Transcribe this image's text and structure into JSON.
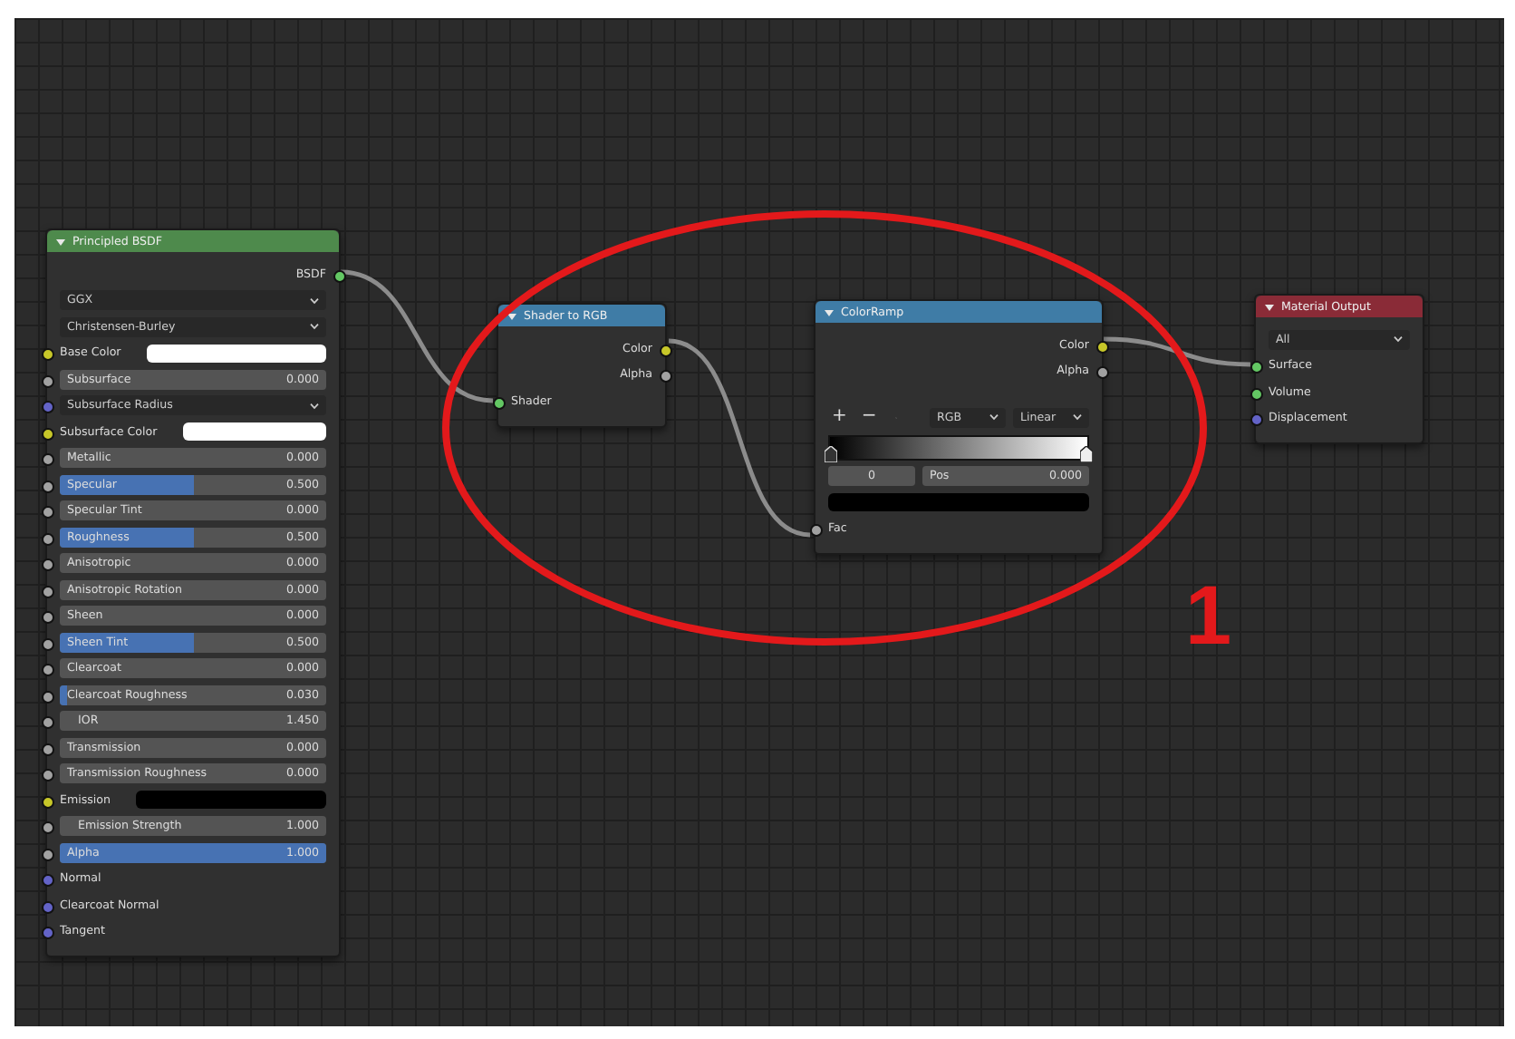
{
  "nodes": [
    {
      "title": "Principled BSDF",
      "color": "#4e8a4c",
      "rows": [
        {
          "kind": "output",
          "label": "BSDF",
          "socket": {
            "color": "#63c763"
          }
        },
        {
          "kind": "dropdown",
          "value": "GGX"
        },
        {
          "kind": "dropdown",
          "value": "Christensen-Burley"
        },
        {
          "kind": "color",
          "label": "Base Color",
          "socket": {
            "color": "#c7c729"
          },
          "color": "#ffffff"
        },
        {
          "kind": "slider",
          "label": "Subsurface",
          "value": "0.000",
          "socket": {
            "color": "#a1a1a1"
          }
        },
        {
          "kind": "dropdown",
          "value": "Subsurface Radius",
          "socket": {
            "color": "#6363c7"
          }
        },
        {
          "kind": "color",
          "label": "Subsurface Color",
          "socket": {
            "color": "#c7c729"
          },
          "color": "#ffffff"
        },
        {
          "kind": "slider",
          "label": "Metallic",
          "value": "0.000",
          "socket": {
            "color": "#a1a1a1"
          }
        },
        {
          "kind": "slider",
          "label": "Specular",
          "value": "0.500",
          "level": 0.5,
          "socket": {
            "color": "#a1a1a1"
          }
        },
        {
          "kind": "slider",
          "label": "Specular Tint",
          "value": "0.000",
          "socket": {
            "color": "#a1a1a1"
          }
        },
        {
          "kind": "slider",
          "label": "Roughness",
          "value": "0.500",
          "level": 0.5,
          "socket": {
            "color": "#a1a1a1"
          }
        },
        {
          "kind": "slider",
          "label": "Anisotropic",
          "value": "0.000",
          "socket": {
            "color": "#a1a1a1"
          }
        },
        {
          "kind": "slider",
          "label": "Anisotropic Rotation",
          "value": "0.000",
          "socket": {
            "color": "#a1a1a1"
          }
        },
        {
          "kind": "slider",
          "label": "Sheen",
          "value": "0.000",
          "socket": {
            "color": "#a1a1a1"
          }
        },
        {
          "kind": "slider",
          "label": "Sheen Tint",
          "value": "0.500",
          "level": 0.5,
          "socket": {
            "color": "#a1a1a1"
          }
        },
        {
          "kind": "slider",
          "label": "Clearcoat",
          "value": "0.000",
          "socket": {
            "color": "#a1a1a1"
          }
        },
        {
          "kind": "slider",
          "label": "Clearcoat Roughness",
          "value": "0.030",
          "level": 0.03,
          "socket": {
            "color": "#a1a1a1"
          }
        },
        {
          "kind": "number",
          "label": "IOR",
          "value": "1.450",
          "socket": {
            "color": "#a1a1a1"
          }
        },
        {
          "kind": "slider",
          "label": "Transmission",
          "value": "0.000",
          "socket": {
            "color": "#a1a1a1"
          }
        },
        {
          "kind": "slider",
          "label": "Transmission Roughness",
          "value": "0.000",
          "socket": {
            "color": "#a1a1a1"
          }
        },
        {
          "kind": "color",
          "label": "Emission",
          "socket": {
            "color": "#c7c729"
          },
          "color": "#000000"
        },
        {
          "kind": "number",
          "label": "Emission Strength",
          "value": "1.000",
          "socket": {
            "color": "#a1a1a1"
          }
        },
        {
          "kind": "slider",
          "label": "Alpha",
          "value": "1.000",
          "level": 1,
          "socket": {
            "color": "#a1a1a1"
          }
        },
        {
          "kind": "input",
          "label": "Normal",
          "socket": {
            "color": "#6363c7"
          }
        },
        {
          "kind": "input",
          "label": "Clearcoat Normal",
          "socket": {
            "color": "#6363c7"
          }
        },
        {
          "kind": "input",
          "label": "Tangent",
          "socket": {
            "color": "#6363c7"
          }
        }
      ]
    },
    {
      "title": "Shader to RGB",
      "color": "#3f7ca6",
      "rows": [
        {
          "kind": "output",
          "label": "Color",
          "socket": {
            "color": "#c7c729"
          }
        },
        {
          "kind": "output",
          "label": "Alpha",
          "socket": {
            "color": "#a1a1a1"
          }
        },
        {
          "kind": "input",
          "label": "Shader",
          "socket": {
            "color": "#63c763"
          }
        }
      ]
    },
    {
      "title": "ColorRamp",
      "color": "#3f7ca6",
      "rows": [
        {
          "kind": "output",
          "label": "Color",
          "socket": {
            "color": "#c7c729"
          }
        },
        {
          "kind": "output",
          "label": "Alpha",
          "socket": {
            "color": "#a1a1a1"
          }
        },
        {
          "kind": "tools",
          "buttons": [
            "+",
            "−"
          ],
          "dropdowns": [
            "RGB",
            "Linear"
          ]
        },
        {
          "kind": "gradient"
        },
        {
          "kind": "stop",
          "index": "0",
          "label": "Pos",
          "value": "0.000"
        },
        {
          "kind": "color",
          "color": "#000000"
        },
        {
          "kind": "input",
          "label": "Fac",
          "socket": {
            "color": "#a1a1a1"
          }
        }
      ]
    },
    {
      "title": "Material Output",
      "color": "#8a2b37",
      "rows": [
        {
          "kind": "dropdown",
          "value": "All"
        },
        {
          "kind": "input",
          "label": "Surface",
          "socket": {
            "color": "#63c763"
          }
        },
        {
          "kind": "input",
          "label": "Volume",
          "socket": {
            "color": "#63c763"
          }
        },
        {
          "kind": "input",
          "label": "Displacement",
          "socket": {
            "color": "#6363c7"
          }
        }
      ]
    }
  ],
  "annotation": {
    "label": "1"
  }
}
